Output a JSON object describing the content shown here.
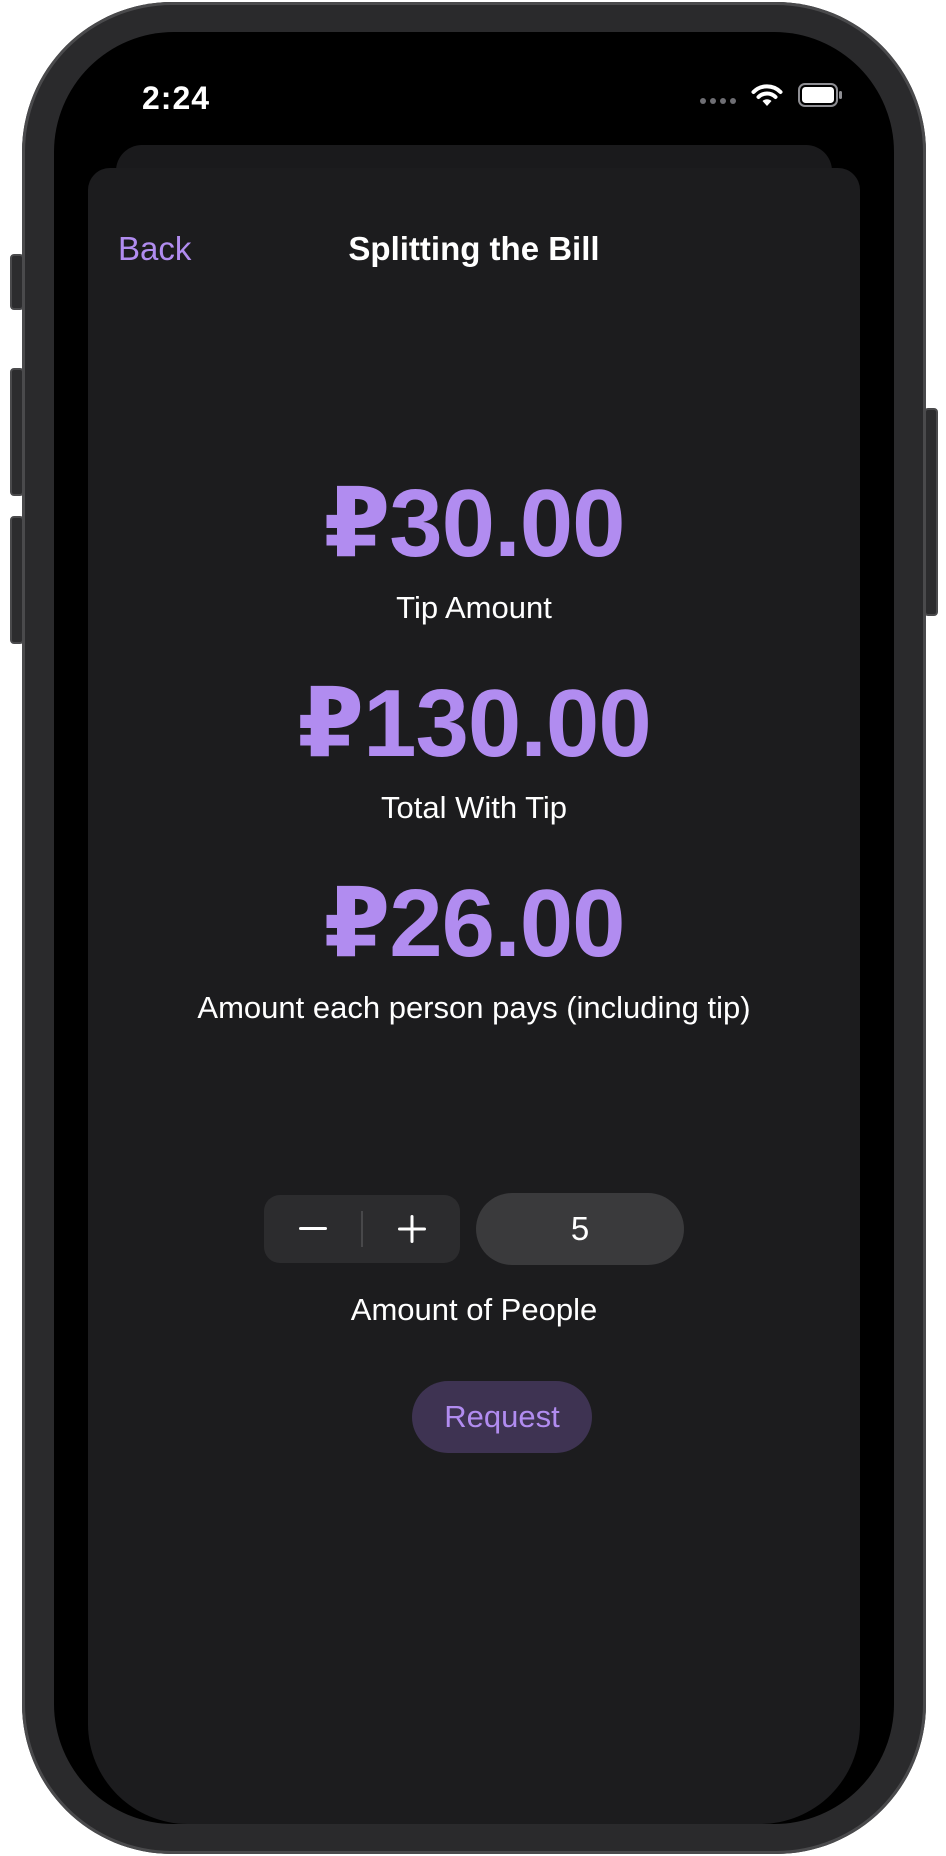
{
  "status_bar": {
    "time": "2:24"
  },
  "nav": {
    "back_label": "Back",
    "title": "Splitting the Bill"
  },
  "tip": {
    "value": "₽30.00",
    "label": "Tip Amount"
  },
  "total": {
    "value": "₽130.00",
    "label": "Total With Tip"
  },
  "per_person": {
    "value": "₽26.00",
    "label": "Amount each person pays (including tip)"
  },
  "people": {
    "count": "5",
    "label": "Amount of People",
    "decrement_icon": "minus-icon",
    "increment_icon": "plus-icon"
  },
  "request_label": "Request",
  "colors": {
    "accent": "#b18cf0",
    "background": "#1c1c1e",
    "request_bg": "#3e3352"
  }
}
